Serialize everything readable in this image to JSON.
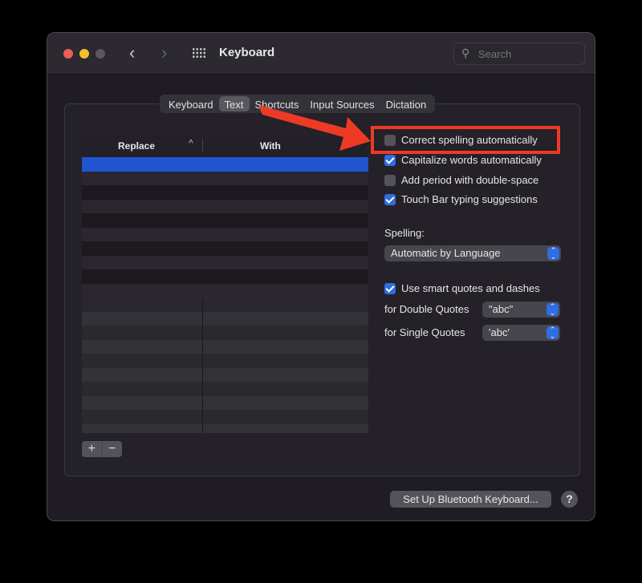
{
  "window": {
    "title": "Keyboard",
    "search_placeholder": "Search"
  },
  "tabs": [
    {
      "label": "Keyboard"
    },
    {
      "label": "Text",
      "selected": true
    },
    {
      "label": "Shortcuts"
    },
    {
      "label": "Input Sources"
    },
    {
      "label": "Dictation"
    }
  ],
  "table": {
    "columns": [
      "Replace",
      "With"
    ],
    "rows": [],
    "add_label": "+",
    "remove_label": "−"
  },
  "options": [
    {
      "label": "Correct spelling automatically",
      "checked": false
    },
    {
      "label": "Capitalize words automatically",
      "checked": true
    },
    {
      "label": "Add period with double-space",
      "checked": false
    },
    {
      "label": "Touch Bar typing suggestions",
      "checked": true
    }
  ],
  "spelling": {
    "label": "Spelling:",
    "value": "Automatic by Language"
  },
  "smart_quotes": {
    "label": "Use smart quotes and dashes",
    "checked": true,
    "double_label": "for Double Quotes",
    "double_value": "\"abc\"",
    "single_label": "for Single Quotes",
    "single_value": "'abc'"
  },
  "footer": {
    "bluetooth_button": "Set Up Bluetooth Keyboard...",
    "help": "?"
  },
  "annotation": {
    "color": "#ee3a25"
  },
  "colors": {
    "accent": "#2f6de0",
    "close": "#ec5f57",
    "minimize": "#f5bf2f",
    "zoom": "#5a585e"
  }
}
